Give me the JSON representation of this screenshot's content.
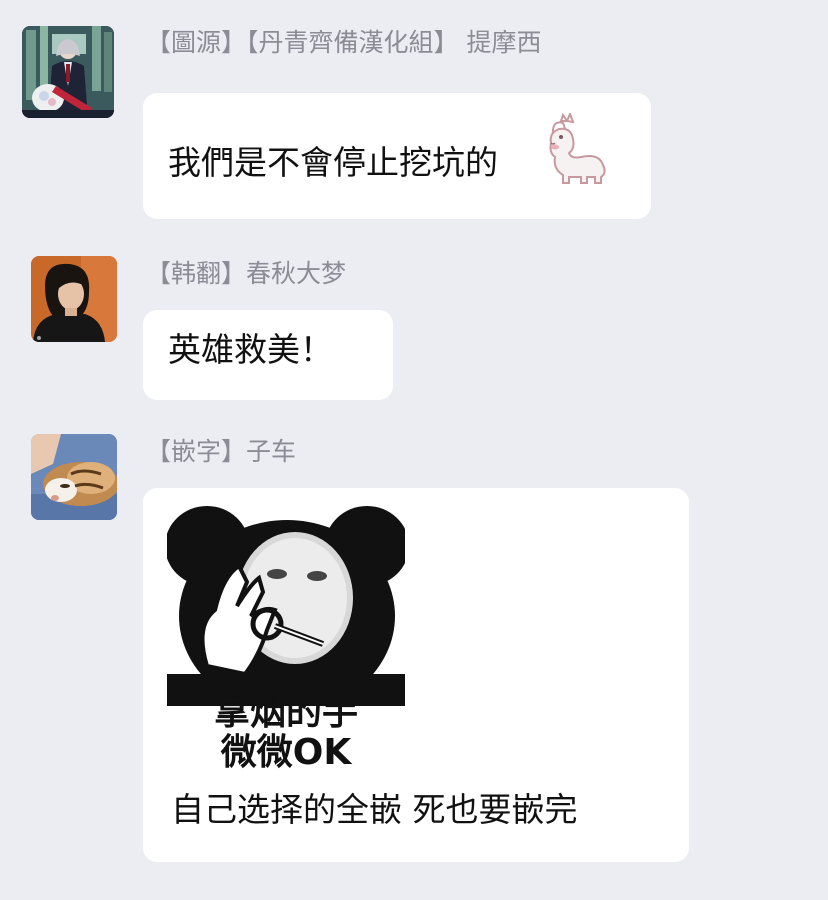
{
  "messages": [
    {
      "sender": "【圖源】【丹青齊備漢化組】 提摩西",
      "text": "我們是不會停止挖坑的",
      "sticker": "alpaca-sticker-icon"
    },
    {
      "sender": "【韩翻】春秋大梦",
      "text": "英雄救美！"
    },
    {
      "sender": "【嵌字】子车",
      "meme_caption_line1": "拿烟的手",
      "meme_caption_line2": "微微OK",
      "text": "自己选择的全嵌 死也要嵌完"
    }
  ],
  "colors": {
    "background": "#ecedf2",
    "bubble": "#ffffff",
    "sender_name": "#8b8d96",
    "message_text": "#111111"
  }
}
